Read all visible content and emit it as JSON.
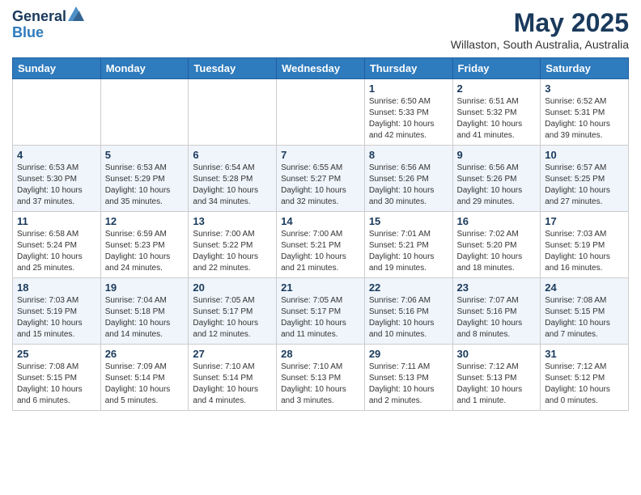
{
  "header": {
    "logo_general": "General",
    "logo_blue": "Blue",
    "month": "May 2025",
    "location": "Willaston, South Australia, Australia"
  },
  "weekdays": [
    "Sunday",
    "Monday",
    "Tuesday",
    "Wednesday",
    "Thursday",
    "Friday",
    "Saturday"
  ],
  "weeks": [
    [
      {
        "day": "",
        "info": ""
      },
      {
        "day": "",
        "info": ""
      },
      {
        "day": "",
        "info": ""
      },
      {
        "day": "",
        "info": ""
      },
      {
        "day": "1",
        "info": "Sunrise: 6:50 AM\nSunset: 5:33 PM\nDaylight: 10 hours\nand 42 minutes."
      },
      {
        "day": "2",
        "info": "Sunrise: 6:51 AM\nSunset: 5:32 PM\nDaylight: 10 hours\nand 41 minutes."
      },
      {
        "day": "3",
        "info": "Sunrise: 6:52 AM\nSunset: 5:31 PM\nDaylight: 10 hours\nand 39 minutes."
      }
    ],
    [
      {
        "day": "4",
        "info": "Sunrise: 6:53 AM\nSunset: 5:30 PM\nDaylight: 10 hours\nand 37 minutes."
      },
      {
        "day": "5",
        "info": "Sunrise: 6:53 AM\nSunset: 5:29 PM\nDaylight: 10 hours\nand 35 minutes."
      },
      {
        "day": "6",
        "info": "Sunrise: 6:54 AM\nSunset: 5:28 PM\nDaylight: 10 hours\nand 34 minutes."
      },
      {
        "day": "7",
        "info": "Sunrise: 6:55 AM\nSunset: 5:27 PM\nDaylight: 10 hours\nand 32 minutes."
      },
      {
        "day": "8",
        "info": "Sunrise: 6:56 AM\nSunset: 5:26 PM\nDaylight: 10 hours\nand 30 minutes."
      },
      {
        "day": "9",
        "info": "Sunrise: 6:56 AM\nSunset: 5:26 PM\nDaylight: 10 hours\nand 29 minutes."
      },
      {
        "day": "10",
        "info": "Sunrise: 6:57 AM\nSunset: 5:25 PM\nDaylight: 10 hours\nand 27 minutes."
      }
    ],
    [
      {
        "day": "11",
        "info": "Sunrise: 6:58 AM\nSunset: 5:24 PM\nDaylight: 10 hours\nand 25 minutes."
      },
      {
        "day": "12",
        "info": "Sunrise: 6:59 AM\nSunset: 5:23 PM\nDaylight: 10 hours\nand 24 minutes."
      },
      {
        "day": "13",
        "info": "Sunrise: 7:00 AM\nSunset: 5:22 PM\nDaylight: 10 hours\nand 22 minutes."
      },
      {
        "day": "14",
        "info": "Sunrise: 7:00 AM\nSunset: 5:21 PM\nDaylight: 10 hours\nand 21 minutes."
      },
      {
        "day": "15",
        "info": "Sunrise: 7:01 AM\nSunset: 5:21 PM\nDaylight: 10 hours\nand 19 minutes."
      },
      {
        "day": "16",
        "info": "Sunrise: 7:02 AM\nSunset: 5:20 PM\nDaylight: 10 hours\nand 18 minutes."
      },
      {
        "day": "17",
        "info": "Sunrise: 7:03 AM\nSunset: 5:19 PM\nDaylight: 10 hours\nand 16 minutes."
      }
    ],
    [
      {
        "day": "18",
        "info": "Sunrise: 7:03 AM\nSunset: 5:19 PM\nDaylight: 10 hours\nand 15 minutes."
      },
      {
        "day": "19",
        "info": "Sunrise: 7:04 AM\nSunset: 5:18 PM\nDaylight: 10 hours\nand 14 minutes."
      },
      {
        "day": "20",
        "info": "Sunrise: 7:05 AM\nSunset: 5:17 PM\nDaylight: 10 hours\nand 12 minutes."
      },
      {
        "day": "21",
        "info": "Sunrise: 7:05 AM\nSunset: 5:17 PM\nDaylight: 10 hours\nand 11 minutes."
      },
      {
        "day": "22",
        "info": "Sunrise: 7:06 AM\nSunset: 5:16 PM\nDaylight: 10 hours\nand 10 minutes."
      },
      {
        "day": "23",
        "info": "Sunrise: 7:07 AM\nSunset: 5:16 PM\nDaylight: 10 hours\nand 8 minutes."
      },
      {
        "day": "24",
        "info": "Sunrise: 7:08 AM\nSunset: 5:15 PM\nDaylight: 10 hours\nand 7 minutes."
      }
    ],
    [
      {
        "day": "25",
        "info": "Sunrise: 7:08 AM\nSunset: 5:15 PM\nDaylight: 10 hours\nand 6 minutes."
      },
      {
        "day": "26",
        "info": "Sunrise: 7:09 AM\nSunset: 5:14 PM\nDaylight: 10 hours\nand 5 minutes."
      },
      {
        "day": "27",
        "info": "Sunrise: 7:10 AM\nSunset: 5:14 PM\nDaylight: 10 hours\nand 4 minutes."
      },
      {
        "day": "28",
        "info": "Sunrise: 7:10 AM\nSunset: 5:13 PM\nDaylight: 10 hours\nand 3 minutes."
      },
      {
        "day": "29",
        "info": "Sunrise: 7:11 AM\nSunset: 5:13 PM\nDaylight: 10 hours\nand 2 minutes."
      },
      {
        "day": "30",
        "info": "Sunrise: 7:12 AM\nSunset: 5:13 PM\nDaylight: 10 hours\nand 1 minute."
      },
      {
        "day": "31",
        "info": "Sunrise: 7:12 AM\nSunset: 5:12 PM\nDaylight: 10 hours\nand 0 minutes."
      }
    ]
  ]
}
